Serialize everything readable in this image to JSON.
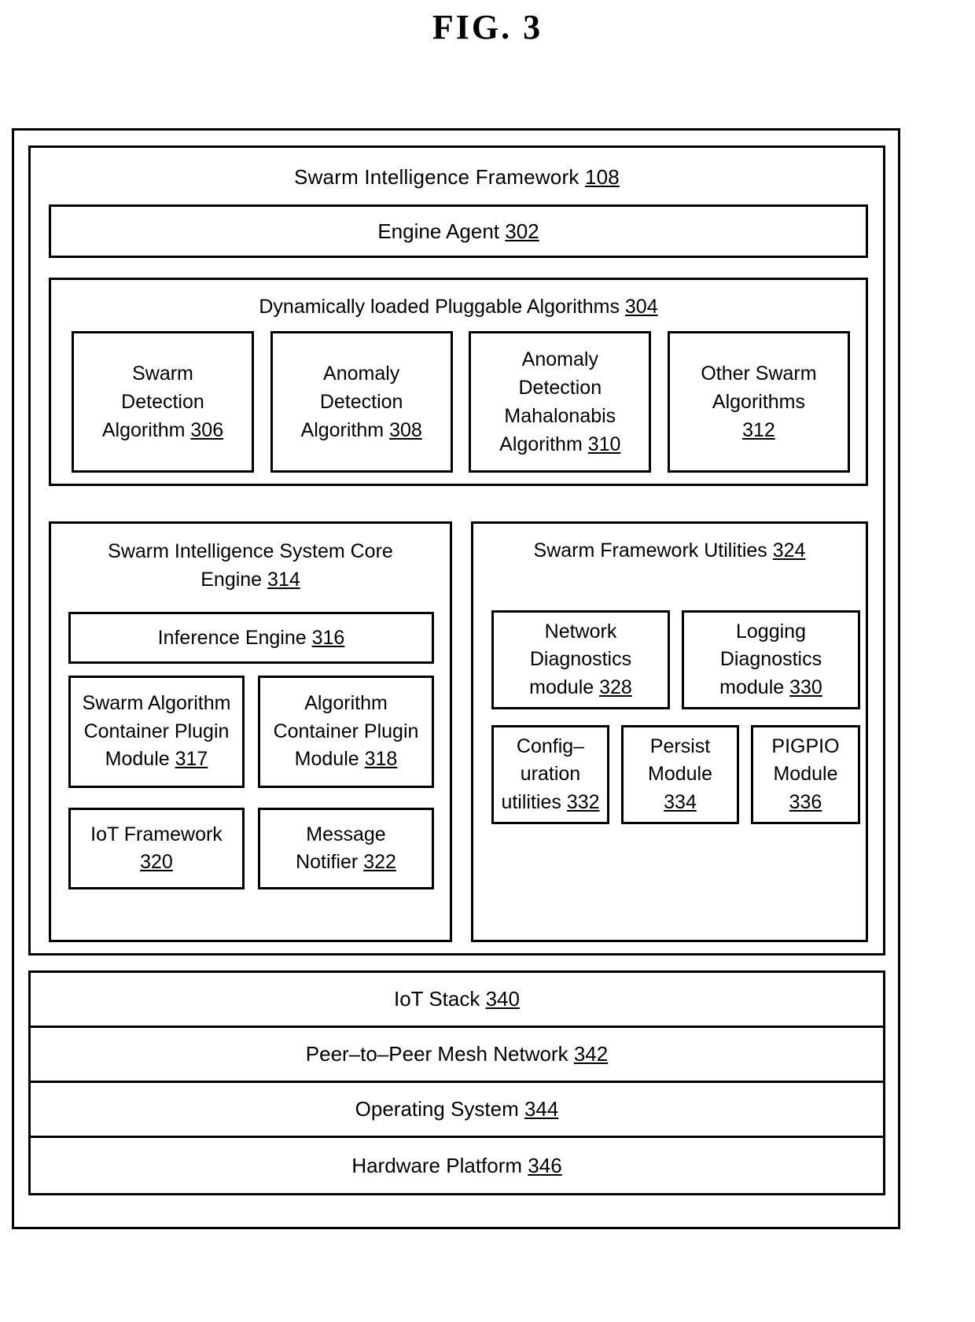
{
  "figure": {
    "title": "FIG.  3"
  },
  "framework": {
    "title_text": "Swarm Intelligence Framework",
    "title_ref": "108",
    "engine_agent": {
      "label": "Engine Agent",
      "ref": "302"
    },
    "pluggable": {
      "title_text": "Dynamically loaded Pluggable Algorithms",
      "title_ref": "304",
      "algorithms": [
        {
          "line1": "Swarm",
          "line2": "Detection",
          "line3": "Algorithm",
          "ref": "306"
        },
        {
          "line1": "Anomaly",
          "line2": "Detection",
          "line3": "Algorithm",
          "ref": "308"
        },
        {
          "line1": "Anomaly",
          "line2": "Detection",
          "line3": "Mahalonabis",
          "line4": "Algorithm",
          "ref": "310"
        },
        {
          "line1": "Other Swarm",
          "line2": "Algorithms",
          "ref": "312"
        }
      ]
    },
    "core_engine": {
      "title_line1": "Swarm Intelligence System  Core",
      "title_line2": "Engine",
      "title_ref": "314",
      "inference_engine": {
        "label": "Inference Engine",
        "ref": "316"
      },
      "modules": [
        {
          "line1": "Swarm Algorithm",
          "line2": "Container Plugin",
          "line3": "Module",
          "ref": "317"
        },
        {
          "line1": "Algorithm",
          "line2": "Container Plugin",
          "line3": "Module",
          "ref": "318"
        },
        {
          "line1": "IoT Framework",
          "ref": "320"
        },
        {
          "line1": "Message",
          "line2": "Notifier",
          "ref": "322"
        }
      ]
    },
    "utilities": {
      "title_text": "Swarm Framework Utilities",
      "title_ref": "324",
      "diagnostics": [
        {
          "line1": "Network",
          "line2": "Diagnostics",
          "line3": "module",
          "ref": "328"
        },
        {
          "line1": "Logging",
          "line2": "Diagnostics",
          "line3": "module",
          "ref": "330"
        }
      ],
      "small_modules": [
        {
          "line1": "Config–",
          "line2": "uration",
          "line3": "utilities",
          "ref": "332"
        },
        {
          "line1": "Persist",
          "line2": "Module",
          "ref": "334"
        },
        {
          "line1": "PIGPIO",
          "line2": "Module",
          "ref": "336"
        }
      ]
    }
  },
  "stack": {
    "rows": [
      {
        "label": "IoT Stack",
        "ref": "340"
      },
      {
        "label": "Peer–to–Peer Mesh Network",
        "ref": "342"
      },
      {
        "label": "Operating System",
        "ref": "344"
      },
      {
        "label": "Hardware Platform",
        "ref": "346"
      }
    ]
  }
}
